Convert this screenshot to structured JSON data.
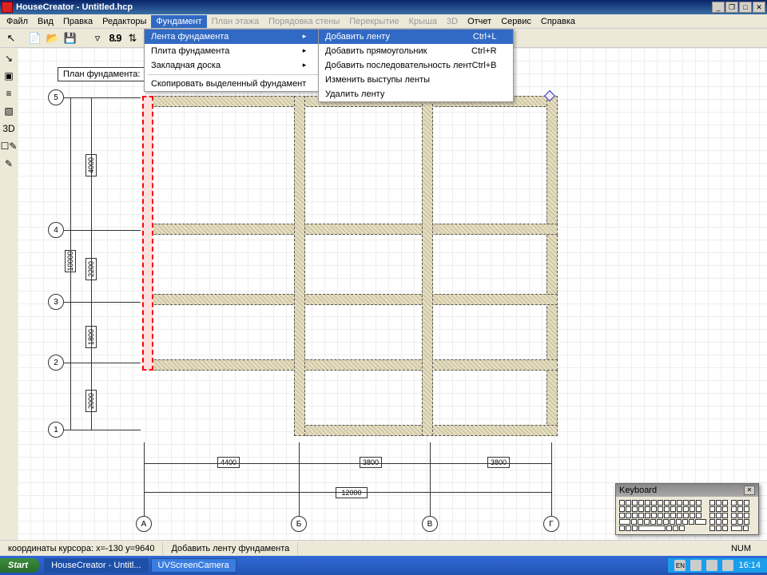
{
  "title": "HouseCreator - Untitled.hcp",
  "menubar": [
    "Файл",
    "Вид",
    "Правка",
    "Редакторы",
    "Фундамент",
    "План этажа",
    "Порядовка стены",
    "Перекрытие",
    "Крыша",
    "3D",
    "Отчет",
    "Сервис",
    "Справка"
  ],
  "menubar_dimmed": [
    5,
    6,
    7,
    8,
    9
  ],
  "menubar_open": 4,
  "toolbar_num": "8.9",
  "left_icons": [
    "↘",
    "▣",
    "≡",
    "▧",
    "3D",
    "☐✎",
    "✎"
  ],
  "plan_label": "План фундамента:",
  "menu1": {
    "items": [
      {
        "label": "Лента фундамента",
        "arrow": true,
        "hl": true
      },
      {
        "label": "Плита фундамента",
        "arrow": true
      },
      {
        "label": "Закладная доска",
        "arrow": true
      },
      {
        "sep": true
      },
      {
        "label": "Скопировать выделенный фундамент"
      }
    ]
  },
  "menu2": {
    "items": [
      {
        "label": "Добавить ленту",
        "shortcut": "Ctrl+L",
        "hl": true
      },
      {
        "label": "Добавить прямоугольник",
        "shortcut": "Ctrl+R"
      },
      {
        "label": "Добавить последовательность лент",
        "shortcut": "Ctrl+B"
      },
      {
        "label": "Изменить выступы ленты"
      },
      {
        "label": "Удалить ленту"
      }
    ]
  },
  "markers_v": [
    "5",
    "4",
    "3",
    "2",
    "1"
  ],
  "markers_h": [
    "А",
    "Б",
    "В",
    "Г"
  ],
  "dims_v": [
    "4000",
    "2200",
    "1800",
    "2000"
  ],
  "dim_v_total": "10000",
  "dims_h": [
    "4400",
    "3800",
    "3800"
  ],
  "dim_h_total": "12000",
  "status_coords": "координаты курсора: x=-130 y=9640",
  "status_hint": "Добавить ленту фундамента",
  "status_num": "NUM",
  "taskbar": {
    "start": "Start",
    "tasks": [
      "HouseCreator - Untitl...",
      "UVScreenCamera"
    ],
    "lang": "EN",
    "time": "16:14"
  },
  "keyboard_title": "Keyboard"
}
